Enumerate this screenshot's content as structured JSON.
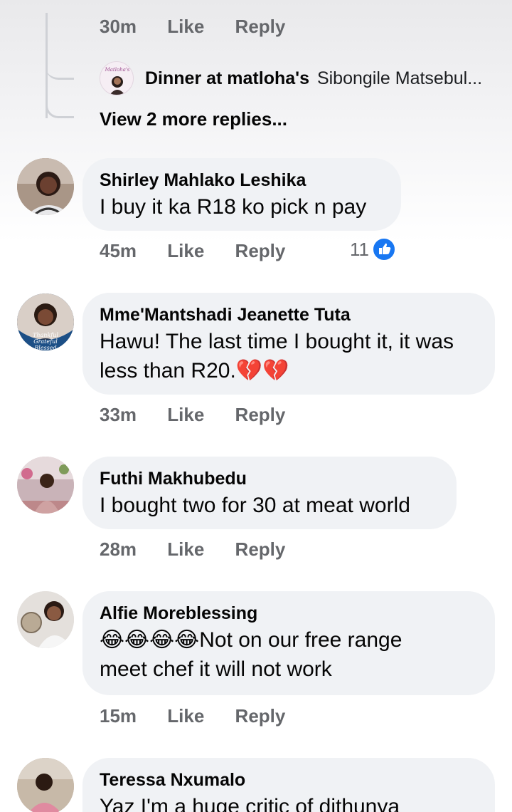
{
  "thread": {
    "prev_meta": {
      "time": "30m",
      "like": "Like",
      "reply": "Reply"
    },
    "nested_reply": {
      "author": "Dinner at matloha's",
      "preview": "Sibongile Matsebul...",
      "avatar_badge": "Matloha's"
    },
    "view_more": "View 2 more replies..."
  },
  "comments": [
    {
      "author": "Shirley Mahlako Leshika",
      "text": "I buy it ka R18 ko pick n pay",
      "time": "45m",
      "like": "Like",
      "reply": "Reply",
      "reaction_count": "11"
    },
    {
      "author": "Mme'Mantshadi Jeanette Tuta",
      "text_line1": "Hawu! The last time I bought it, it was",
      "text_line2": "less than R20.",
      "text_emoji": "💔💔",
      "avatar_caption": "Thankful Grateful Blessed",
      "time": "33m",
      "like": "Like",
      "reply": "Reply"
    },
    {
      "author": "Futhi Makhubedu",
      "text": "I bought two for 30 at meat world",
      "time": "28m",
      "like": "Like",
      "reply": "Reply"
    },
    {
      "author": "Alfie Moreblessing",
      "text_emoji": "😂😂😂😂",
      "text_line1": "Not on our free range",
      "text_line2": "meet chef it will not work",
      "time": "15m",
      "like": "Like",
      "reply": "Reply"
    },
    {
      "author": "Teressa Nxumalo",
      "text": "Yaz I'm a huge critic of dithunya"
    }
  ],
  "colors": {
    "bubble": "#f0f2f5",
    "meta_text": "#65676b",
    "like_blue": "#1877f2"
  }
}
